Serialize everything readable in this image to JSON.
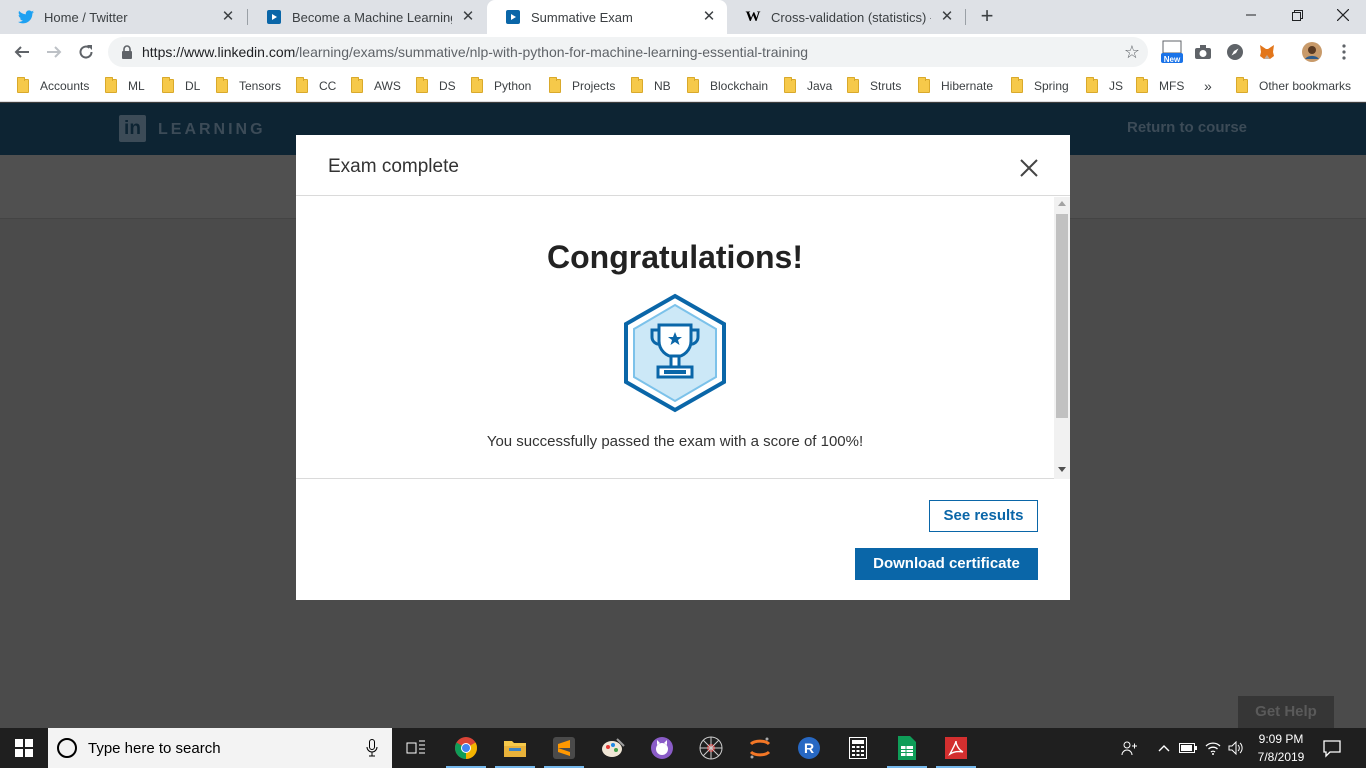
{
  "browser": {
    "tabs": [
      {
        "title": "Home / Twitter",
        "icon": "twitter-bird-icon",
        "active": false
      },
      {
        "title": "Become a Machine Learning Spe",
        "icon": "linkedin-learning-icon",
        "active": false
      },
      {
        "title": "Summative Exam",
        "icon": "linkedin-learning-icon",
        "active": true
      },
      {
        "title": "Cross-validation (statistics) - Wik",
        "icon": "wikipedia-icon",
        "active": false
      }
    ],
    "new_tab": "+",
    "url_host": "https://www.linkedin.com",
    "url_path": "/learning/exams/summative/nlp-with-python-for-machine-learning-essential-training",
    "new_badge": "New",
    "bookmarks": [
      "Accounts",
      "ML",
      "DL",
      "Tensors",
      "CC",
      "AWS",
      "DS",
      "Python",
      "Projects",
      "NB",
      "Blockchain",
      "Java",
      "Struts",
      "Hibernate",
      "Spring",
      "JS",
      "MFS"
    ],
    "bookmarks_overflow": "»",
    "other_bookmarks": "Other bookmarks"
  },
  "page": {
    "logo_text": "in",
    "wordmark": "LEARNING",
    "return_link": "Return to course",
    "get_help": "Get Help"
  },
  "modal": {
    "title": "Exam complete",
    "heading": "Congratulations!",
    "message": "You successfully passed the exam with a score of 100%!",
    "see_results": "See results",
    "download": "Download certificate"
  },
  "taskbar": {
    "search_placeholder": "Type here to search",
    "time": "9:09 PM",
    "date": "7/8/2019"
  },
  "colors": {
    "linkedin_blue": "#0a66a8",
    "header_navy": "#0d2433",
    "trophy_light": "#cce8f7"
  }
}
